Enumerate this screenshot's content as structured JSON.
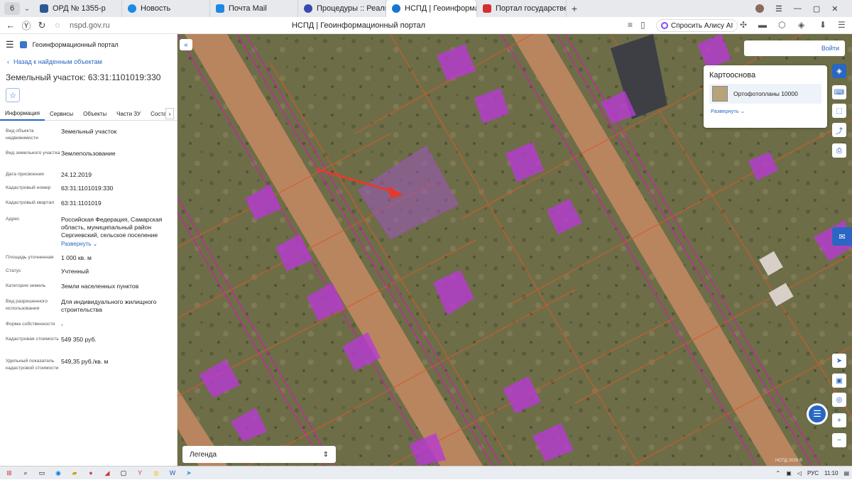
{
  "browser": {
    "tab_count": "6",
    "tabs": [
      {
        "label": "ОРД № 1355-р",
        "color": "#2b5797",
        "active": false
      },
      {
        "label": "Новость",
        "color": "#1e88e5",
        "active": false
      },
      {
        "label": "Почта Mail",
        "color": "#1e88e5",
        "active": false
      },
      {
        "label": "Процедуры :: Реализаци",
        "color": "#3949ab",
        "active": false
      },
      {
        "label": "НСПД | Геоинформаци",
        "color": "#1976d2",
        "active": true
      },
      {
        "label": "Портал государственных",
        "color": "#d32f2f",
        "active": false
      }
    ],
    "url": "nspd.gov.ru",
    "page_title": "НСПД | Геоинформационный портал",
    "alice_label": "Спросить Алису AI"
  },
  "sidebar": {
    "portal_name": "Геоинформационный портал",
    "back_label": "Назад к найденным объектам",
    "object_title": "Земельный участок: 63:31:1101019:330",
    "tabs": [
      "Информация",
      "Сервисы",
      "Объекты",
      "Части ЗУ",
      "Состав"
    ],
    "properties": [
      {
        "key": "Вид объекта недвижимости",
        "value": "Земельный участок"
      },
      {
        "key": "Вид земельного участка",
        "value": "Землепользование"
      },
      {
        "key": "Дата присвоения",
        "value": "24.12.2019"
      },
      {
        "key": "Кадастровый номер",
        "value": "63:31:1101019:330"
      },
      {
        "key": "Кадастровый квартал",
        "value": "63:31:1101019"
      },
      {
        "key": "Адрес",
        "value": "Российская Федерация, Самарская область, муниципальный район Сергиевский, сельское поселение"
      },
      {
        "key": "Площадь уточненная",
        "value": "1 000 кв. м"
      },
      {
        "key": "Статус",
        "value": "Учтенный"
      },
      {
        "key": "Категория земель",
        "value": "Земли населенных пунктов"
      },
      {
        "key": "Вид разрешенного использования",
        "value": "Для индивидуального жилищного строительства"
      },
      {
        "key": "Форма собственности",
        "value": "-"
      },
      {
        "key": "Кадастровая стоимость",
        "value": "549 350 руб."
      },
      {
        "key": "Удельный показатель кадастровой стоимости",
        "value": "549,35 руб./кв. м"
      }
    ],
    "address_expand": "Развернуть"
  },
  "map": {
    "login_label": "Войти",
    "basemap_title": "Картооснова",
    "basemap_item": "Ортофотопланы 10000",
    "basemap_expand": "Развернуть",
    "legend_label": "Легенда",
    "copyright": "НСПД 2026 ©"
  },
  "taskbar": {
    "language": "РУС",
    "time": "11:10"
  }
}
